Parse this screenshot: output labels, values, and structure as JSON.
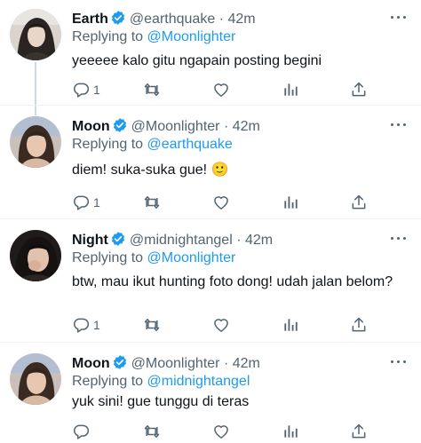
{
  "tweets": [
    {
      "name": "Earth",
      "handle": "@earthquake",
      "separator": "·",
      "time": "42m",
      "replying_prefix": "Replying to",
      "replying_to": "@Moonlighter",
      "text": "yeeeee kalo gitu ngapain posting begini",
      "reply_count": "1"
    },
    {
      "name": "Moon",
      "handle": "@Moonlighter",
      "separator": "·",
      "time": "42m",
      "replying_prefix": "Replying to",
      "replying_to": "@earthquake",
      "text": "diem! suka-suka gue! 🙂",
      "reply_count": "1"
    },
    {
      "name": "Night",
      "handle": "@midnightangel",
      "separator": "·",
      "time": "42m",
      "replying_prefix": "Replying to",
      "replying_to": "@Moonlighter",
      "text": "btw, mau ikut hunting foto dong! udah jalan belom?",
      "reply_count": "1"
    },
    {
      "name": "Moon",
      "handle": "@Moonlighter",
      "separator": "·",
      "time": "42m",
      "replying_prefix": "Replying to",
      "replying_to": "@midnightangel",
      "text": "yuk sini! gue tunggu di teras",
      "reply_count": ""
    }
  ],
  "icons": {
    "verified": "verified-badge-icon",
    "more": "more-options-icon",
    "reply": "reply-icon",
    "retweet": "retweet-icon",
    "like": "like-icon",
    "analytics": "analytics-icon",
    "share": "share-icon"
  },
  "colors": {
    "accent": "#1d9bf0",
    "secondary_text": "#536471",
    "thread_line": "#cfd9de",
    "divider": "#eff3f4"
  }
}
